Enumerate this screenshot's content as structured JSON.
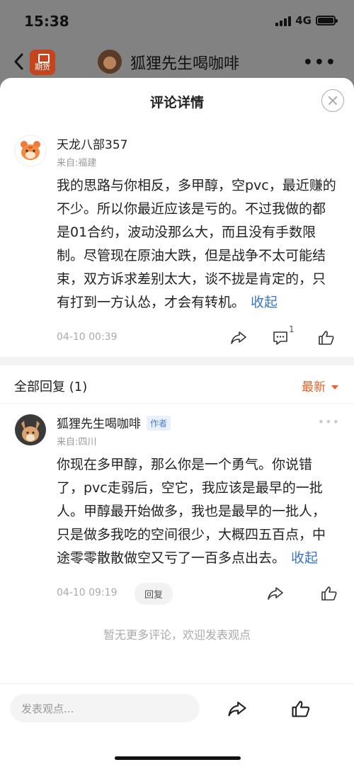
{
  "status": {
    "time": "15:38",
    "network": "4G"
  },
  "nav": {
    "app_badge": "期货",
    "title": "狐狸先生喝咖啡",
    "more": "•••"
  },
  "sheet": {
    "title": "评论详情"
  },
  "comment": {
    "username": "天龙八部357",
    "location": "来自:福建",
    "text": "我的思路与你相反，多甲醇，空pvc，最近赚的不少。所以你最近应该是亏的。不过我做的都是01合约，波动没那么大，而且没有手数限制。尽管现在原油大跌，但是战争不太可能结束，双方诉求差别太大，谈不拢是肯定的，只有打到一方认怂，才会有转机。",
    "collapse": "收起",
    "time": "04-10 00:39",
    "reply_count": "1"
  },
  "replies": {
    "title": "全部回复 (1)",
    "sort": "最新",
    "items": [
      {
        "username": "狐狸先生喝咖啡",
        "tag": "作者",
        "location": "来自:四川",
        "text": "你现在多甲醇，那么你是一个勇气。你说错了，pvc走弱后，空它，我应该是最早的一批人。甲醇最开始做多，我也是最早的一批人，只是做多我吃的空间很少，大概四五百点，中途零零散散做空又亏了一百多点出去。",
        "collapse": "收起",
        "time": "04-10 09:19",
        "reply_label": "回复",
        "more": "•••"
      }
    ]
  },
  "no_more": "暂无更多评论，欢迎发表观点",
  "bottom": {
    "placeholder": "发表观点..."
  }
}
